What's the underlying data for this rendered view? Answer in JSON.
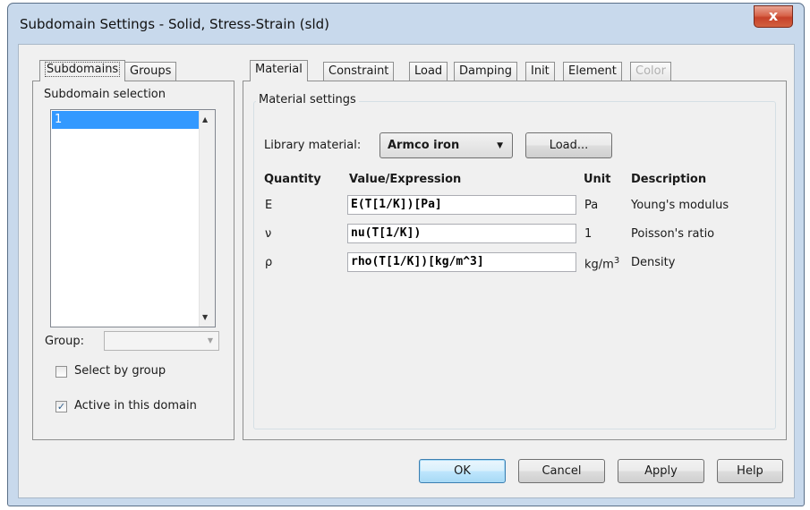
{
  "window": {
    "title": "Subdomain Settings - Solid, Stress-Strain (sld)",
    "close_glyph": "x"
  },
  "left_tabs": [
    {
      "label": "Subdomains"
    },
    {
      "label": "Groups"
    }
  ],
  "subdomain_selection": {
    "legend": "Subdomain selection",
    "items": [
      "1"
    ],
    "selected": "1",
    "scroll_up": "▲",
    "scroll_down": "▼"
  },
  "group_select": {
    "label": "Group:",
    "value": "",
    "arrow": "▼"
  },
  "checkboxes": {
    "select_by_group": {
      "label": "Select by group",
      "checked": false
    },
    "active_in_domain": {
      "label": "Active in this domain",
      "checked": true,
      "mark": "✓"
    }
  },
  "right_tabs": [
    {
      "label": "Material",
      "active": true
    },
    {
      "label": "Constraint"
    },
    {
      "label": "Load"
    },
    {
      "label": "Damping"
    },
    {
      "label": "Init"
    },
    {
      "label": "Element"
    },
    {
      "label": "Color",
      "disabled": true
    }
  ],
  "material": {
    "legend": "Material settings",
    "library_label": "Library material:",
    "library_value": "Armco iron",
    "library_arrow": "▼",
    "load_button": "Load...",
    "headers": {
      "quantity": "Quantity",
      "value": "Value/Expression",
      "unit": "Unit",
      "description": "Description"
    },
    "rows": [
      {
        "quantity": "E",
        "value": "E(T[1/K])[Pa]",
        "unit": "Pa",
        "unit_sup": "",
        "description": "Young's modulus"
      },
      {
        "quantity": "ν",
        "value": "nu(T[1/K])",
        "unit": "1",
        "unit_sup": "",
        "description": "Poisson's ratio"
      },
      {
        "quantity": "ρ",
        "value": "rho(T[1/K])[kg/m^3]",
        "unit": "kg/m",
        "unit_sup": "3",
        "description": "Density"
      }
    ]
  },
  "buttons": {
    "ok": "OK",
    "cancel": "Cancel",
    "apply": "Apply",
    "help": "Help"
  },
  "colors": {
    "selection": "#3399ff",
    "title_bar": "#c8d9ec",
    "close": "#c6422a"
  }
}
